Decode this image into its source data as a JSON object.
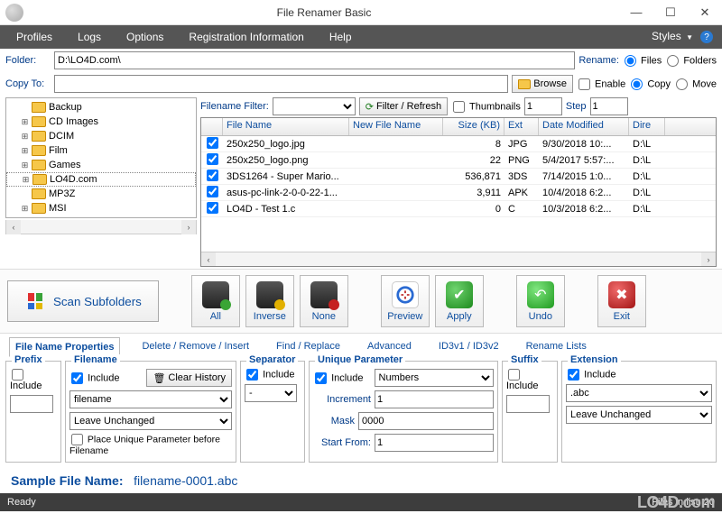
{
  "window": {
    "title": "File Renamer Basic"
  },
  "menu": {
    "items": [
      "Profiles",
      "Logs",
      "Options",
      "Registration Information",
      "Help"
    ],
    "styles_label": "Styles"
  },
  "folder_row": {
    "folder_label": "Folder:",
    "folder_value": "D:\\LO4D.com\\",
    "rename_label": "Rename:",
    "files_label": "Files",
    "folders_label": "Folders"
  },
  "copyto_row": {
    "copyto_label": "Copy To:",
    "copyto_value": "",
    "browse_label": "Browse",
    "enable_label": "Enable",
    "copy_label": "Copy",
    "move_label": "Move"
  },
  "tree": {
    "items": [
      {
        "label": "Backup",
        "expandable": false
      },
      {
        "label": "CD Images",
        "expandable": true
      },
      {
        "label": "DCIM",
        "expandable": true
      },
      {
        "label": "Film",
        "expandable": true
      },
      {
        "label": "Games",
        "expandable": true
      },
      {
        "label": "LO4D.com",
        "expandable": true,
        "selected": true
      },
      {
        "label": "MP3Z",
        "expandable": false
      },
      {
        "label": "MSI",
        "expandable": true
      }
    ]
  },
  "filter_row": {
    "filter_label": "Filename Filter:",
    "filter_value": "",
    "refresh_label": "Filter / Refresh",
    "thumbs_label": "Thumbnails",
    "thumbs_value": "1",
    "step_label": "Step",
    "step_value": "1"
  },
  "table": {
    "headers": [
      "File Name",
      "New File Name",
      "Size (KB)",
      "Ext",
      "Date Modified",
      "Dire"
    ],
    "rows": [
      {
        "checked": true,
        "name": "250x250_logo.jpg",
        "newname": "",
        "size": "8",
        "ext": "JPG",
        "date": "9/30/2018 10:...",
        "dir": "D:\\L"
      },
      {
        "checked": true,
        "name": "250x250_logo.png",
        "newname": "",
        "size": "22",
        "ext": "PNG",
        "date": "5/4/2017 5:57:...",
        "dir": "D:\\L"
      },
      {
        "checked": true,
        "name": "3DS1264 - Super Mario...",
        "newname": "",
        "size": "536,871",
        "ext": "3DS",
        "date": "7/14/2015 1:0...",
        "dir": "D:\\L"
      },
      {
        "checked": true,
        "name": "asus-pc-link-2-0-0-22-1...",
        "newname": "",
        "size": "3,911",
        "ext": "APK",
        "date": "10/4/2018 6:2...",
        "dir": "D:\\L"
      },
      {
        "checked": true,
        "name": "LO4D - Test 1.c",
        "newname": "",
        "size": "0",
        "ext": "C",
        "date": "10/3/2018 6:2...",
        "dir": "D:\\L"
      }
    ]
  },
  "toolbar": {
    "scan_label": "Scan Subfolders",
    "all": "All",
    "inverse": "Inverse",
    "none": "None",
    "preview": "Preview",
    "apply": "Apply",
    "undo": "Undo",
    "exit": "Exit"
  },
  "prop_tabs": [
    "File Name Properties",
    "Delete / Remove / Insert",
    "Find / Replace",
    "Advanced",
    "ID3v1 / ID3v2",
    "Rename Lists"
  ],
  "props": {
    "prefix": {
      "legend": "Prefix",
      "include": "Include",
      "value": ""
    },
    "filename": {
      "legend": "Filename",
      "include": "Include",
      "clear": "Clear History",
      "name_value": "filename",
      "case_value": "Leave Unchanged",
      "place_label": "Place Unique Parameter before Filename"
    },
    "separator": {
      "legend": "Separator",
      "include": "Include",
      "value": "-"
    },
    "unique": {
      "legend": "Unique Parameter",
      "include": "Include",
      "type_value": "Numbers",
      "increment_label": "Increment",
      "increment_value": "1",
      "mask_label": "Mask",
      "mask_value": "0000",
      "start_label": "Start From:",
      "start_value": "1"
    },
    "suffix": {
      "legend": "Suffix",
      "include": "Include",
      "value": ""
    },
    "extension": {
      "legend": "Extension",
      "include": "Include",
      "value": ".abc",
      "case_value": "Leave Unchanged"
    }
  },
  "sample": {
    "label": "Sample File Name:",
    "value": "filename-0001.abc"
  },
  "status": {
    "left": "Ready",
    "files": "Files in list: 20"
  },
  "watermark": "LO4D.com"
}
